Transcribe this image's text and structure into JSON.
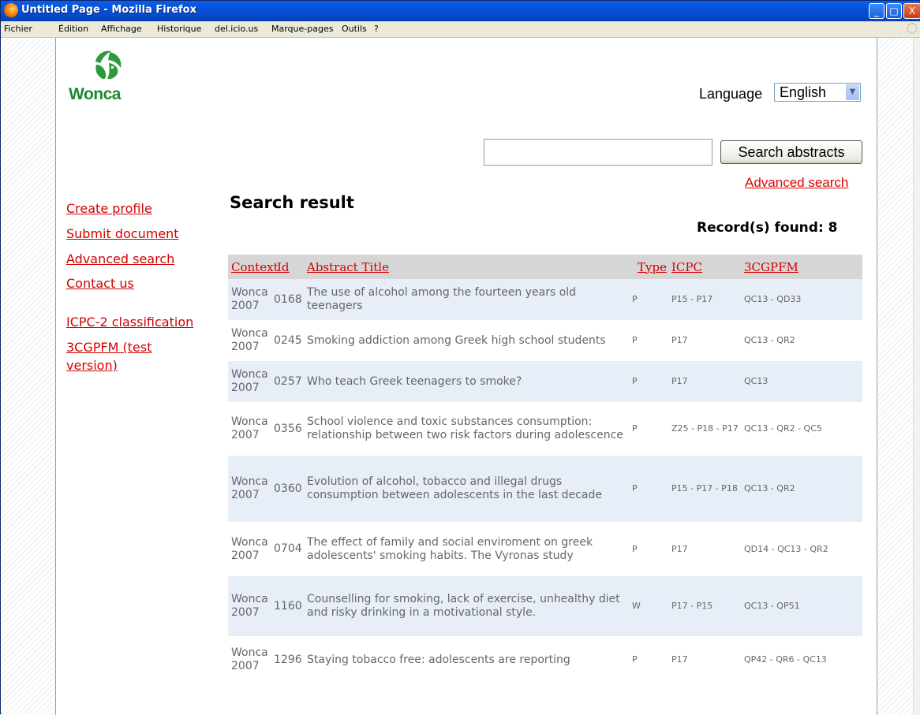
{
  "window": {
    "title": "Untitled Page - Mozilla Firefox",
    "buttons": {
      "minimize": "_",
      "maximize": "□",
      "close": "X"
    }
  },
  "menu": [
    "Fichier",
    "Édition",
    "Affichage",
    "Historique",
    "del.icio.us",
    "Marque-pages",
    "Outils",
    "?"
  ],
  "logo": {
    "text": "Wonca"
  },
  "language": {
    "label": "Language",
    "value": "English"
  },
  "search": {
    "value": "",
    "button": "Search abstracts",
    "advanced_link": "Advanced search"
  },
  "sidebar": {
    "links": [
      "Create profile",
      "Submit document",
      "Advanced search",
      "Contact us",
      "ICPC-2 classification",
      "3CGPFM (test",
      "version)"
    ]
  },
  "results": {
    "title": "Search result",
    "count_text": "Record(s) found: 8",
    "columns": [
      "Context",
      "Id",
      "Abstract Title",
      "Type",
      "ICPC",
      "3CGPFM"
    ],
    "rows": [
      {
        "context": "Wonca 2007",
        "id": "0168",
        "title": "The use of alcohol among the fourteen years old teenagers",
        "type": "P",
        "icpc": "P15 - P17",
        "cg": "QC13 - QD33"
      },
      {
        "context": "Wonca 2007",
        "id": "0245",
        "title": "Smoking addiction among Greek high school students",
        "type": "P",
        "icpc": "P17",
        "cg": "QC13 - QR2"
      },
      {
        "context": "Wonca 2007",
        "id": "0257",
        "title": "Who teach Greek teenagers to smoke?",
        "type": "P",
        "icpc": "P17",
        "cg": "QC13"
      },
      {
        "context": "Wonca 2007",
        "id": "0356",
        "title": "School violence and toxic substances consumption: relationship between two risk factors during adolescence",
        "type": "P",
        "icpc": "Z25 - P18 - P17",
        "cg": "QC13 - QR2 - QC5"
      },
      {
        "context": "Wonca 2007",
        "id": "0360",
        "title": "Evolution of alcohol, tobacco and illegal drugs consumption between adolescents in the last decade",
        "type": "P",
        "icpc": "P15 - P17 - P18",
        "cg": "QC13 - QR2"
      },
      {
        "context": "Wonca 2007",
        "id": "0704",
        "title": "The effect of family and social enviroment on greek adolescents' smoking habits. The Vyronas study",
        "type": "P",
        "icpc": "P17",
        "cg": "QD14 - QC13 - QR2"
      },
      {
        "context": "Wonca 2007",
        "id": "1160",
        "title": "Counselling for smoking, lack of exercise, unhealthy diet and risky drinking in a motivational style.",
        "type": "W",
        "icpc": "P17 - P15",
        "cg": "QC13 - QP51"
      },
      {
        "context": "Wonca 2007",
        "id": "1296",
        "title": "Staying tobacco free: adolescents are reporting",
        "type": "P",
        "icpc": "P17",
        "cg": "QP42 - QR6 - QC13"
      }
    ]
  }
}
